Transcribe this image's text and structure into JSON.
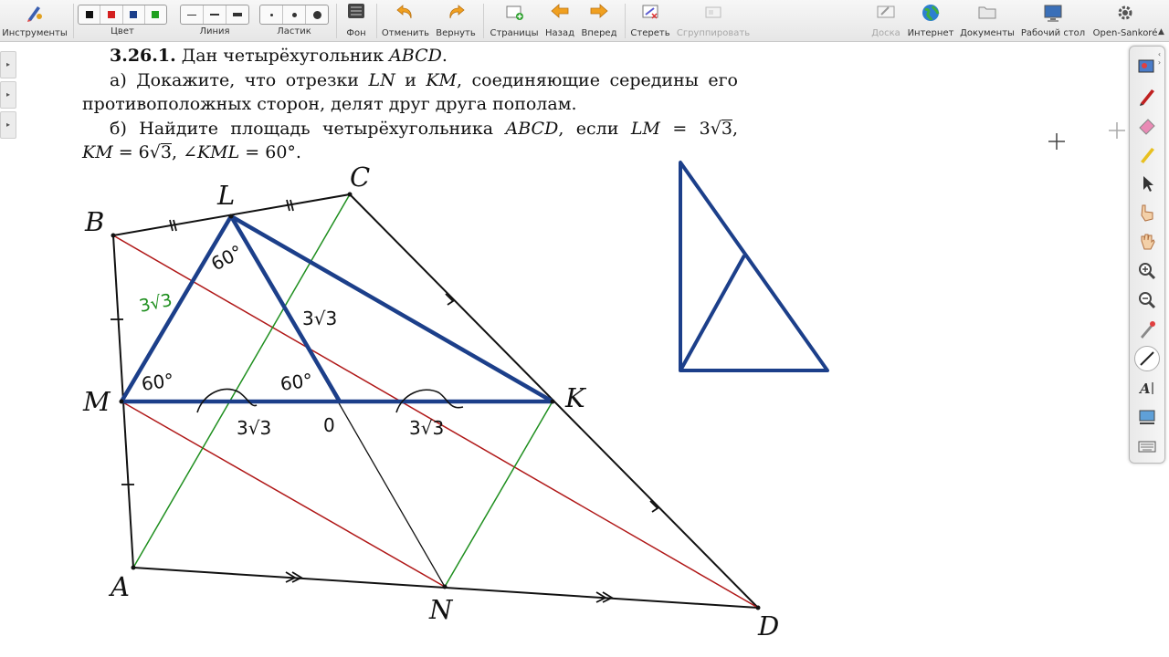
{
  "toolbar": {
    "tools_label": "Инструменты",
    "color_label": "Цвет",
    "line_label": "Линия",
    "eraser_label": "Ластик",
    "background_label": "Фон",
    "undo_label": "Отменить",
    "redo_label": "Вернуть",
    "pages_label": "Страницы",
    "back_label": "Назад",
    "forward_label": "Вперед",
    "erase_label": "Стереть",
    "group_label": "Сгруппировать",
    "board_label": "Доска",
    "internet_label": "Интернет",
    "documents_label": "Документы",
    "desktop_label": "Рабочий стол",
    "app_label": "Open-Sankoré",
    "colors": [
      "#111111",
      "#d42020",
      "#1c3f8a",
      "#20a020"
    ]
  },
  "problem": {
    "number": "3.26.1.",
    "title_text": "Дан четырёхугольник",
    "title_var": "ABCD",
    "part_a_prefix": "а) Докажите, что отрезки",
    "part_a_seg1": "LN",
    "part_a_and": "и",
    "part_a_seg2": "KM",
    "part_a_rest": ", соединяющие середины его",
    "part_a_line2": "противоположных сторон, делят друг друга пополам.",
    "part_b_prefix": "б) Найдите площадь четырёхугольника",
    "part_b_var": "ABCD",
    "part_b_if": ", если",
    "part_b_lm": "LM",
    "part_b_eq1": "= 3",
    "part_b_rad1": "3",
    "part_b_line2_km": "KM",
    "part_b_eq2": "= 6",
    "part_b_rad2": "3",
    "part_b_angle": "∠KML",
    "part_b_deg": "= 60°."
  },
  "figure": {
    "labels": {
      "A": "A",
      "B": "B",
      "C": "C",
      "D": "D",
      "K": "K",
      "L": "L",
      "M": "M",
      "N": "N"
    },
    "annotations": {
      "side_ml": "3√3",
      "side_ln": "3√3",
      "half_mo": "3√3",
      "half_ok": "3√3",
      "center": "0",
      "angle_l": "60°",
      "angle_m": "60°",
      "angle_o": "60°"
    },
    "colors": {
      "triangle": "#1c3f8a",
      "diagonal_bd": "#b01818",
      "mid_green": "#1f8f1f",
      "quad": "#111111"
    }
  }
}
